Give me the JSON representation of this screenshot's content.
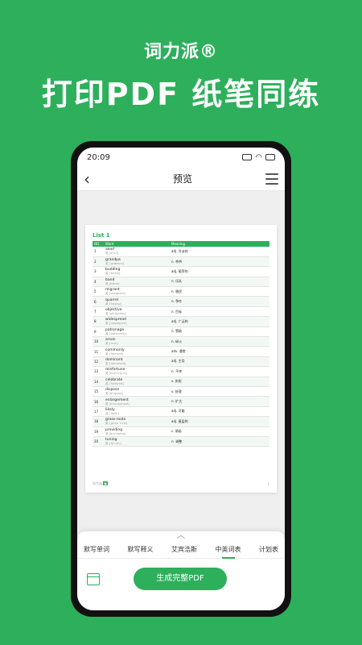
{
  "hero": {
    "brand": "词力派®",
    "title": "打印PDF 纸笔同练"
  },
  "status": {
    "time": "20:09"
  },
  "nav": {
    "title": "预览",
    "back": "‹"
  },
  "document": {
    "list_title": "List 1",
    "columns": [
      "NO.",
      "Word",
      "Meaning"
    ],
    "rows": [
      {
        "no": "1",
        "word": "aloof",
        "pron": "英 [əˈluːf]",
        "meaning": "adj. 冷淡的"
      },
      {
        "no": "2",
        "word": "grandpa",
        "pron": "英 [ˈɡrænpɑː]",
        "meaning": "n. 爷爷"
      },
      {
        "no": "3",
        "word": "budding",
        "pron": "英 [ˈbʌdɪŋ]",
        "meaning": "adj. 萌芽的"
      },
      {
        "no": "4",
        "word": "band",
        "pron": "英 [bænd]",
        "meaning": "n. 乐队"
      },
      {
        "no": "5",
        "word": "migrant",
        "pron": "英 [ˈmaɪɡrənt]",
        "meaning": "n. 移民"
      },
      {
        "no": "6",
        "word": "quarrel",
        "pron": "英 [ˈkwɒrəl]",
        "meaning": "n. 争吵"
      },
      {
        "no": "7",
        "word": "objective",
        "pron": "英 [əbˈdʒektɪv]",
        "meaning": "n. 目标"
      },
      {
        "no": "8",
        "word": "widespread",
        "pron": "英 [ˈwaɪdspred]",
        "meaning": "adj. 广泛的"
      },
      {
        "no": "9",
        "word": "patronage",
        "pron": "英 [ˈpætrənɪdʒ]",
        "meaning": "n. 赞助"
      },
      {
        "no": "10",
        "word": "arson",
        "pron": "英 [ˈɑːsn]",
        "meaning": "n. 纵火"
      },
      {
        "no": "11",
        "word": "commonly",
        "pron": "英 [ˈkɒmənli]",
        "meaning": "adv. 通常"
      },
      {
        "no": "12",
        "word": "dominant",
        "pron": "英 [ˈdɒmɪnənt]",
        "meaning": "adj. 主导"
      },
      {
        "no": "13",
        "word": "misfortune",
        "pron": "英 [mɪsˈfɔːtʃuːn]",
        "meaning": "n. 不幸"
      },
      {
        "no": "14",
        "word": "celebrate",
        "pron": "英 [ˈselɪbreɪt]",
        "meaning": "v. 庆祝"
      },
      {
        "no": "15",
        "word": "dispose",
        "pron": "英 [dɪˈspəʊz]",
        "meaning": "v. 处理"
      },
      {
        "no": "16",
        "word": "enlargement",
        "pron": "英 [ɪnˈlɑːdʒmənt]",
        "meaning": "n. 扩大"
      },
      {
        "no": "17",
        "word": "likely",
        "pron": "英 [ˈlaɪkli]",
        "meaning": "adj. 可能"
      },
      {
        "no": "18",
        "word": "grass-roots",
        "pron": "英 [ˌɡrɑːs ˈruːts]",
        "meaning": "adj. 基层的"
      },
      {
        "no": "19",
        "word": "providing",
        "pron": "英 [prəˈvaɪdɪŋ]",
        "meaning": "c. 倘若"
      },
      {
        "no": "20",
        "word": "tuning",
        "pron": "英 [ˈtjuːnɪŋ]",
        "meaning": "n. 调整"
      }
    ],
    "footer_brand": "词力派",
    "page_number": "1"
  },
  "bottom": {
    "chevron": "︿",
    "tabs": [
      "默写单词",
      "默写释义",
      "艾宾浩斯",
      "中英词表",
      "计划表"
    ],
    "active_tab": 3,
    "generate_label": "生成完整PDF"
  },
  "colors": {
    "accent": "#2eaf5c"
  }
}
